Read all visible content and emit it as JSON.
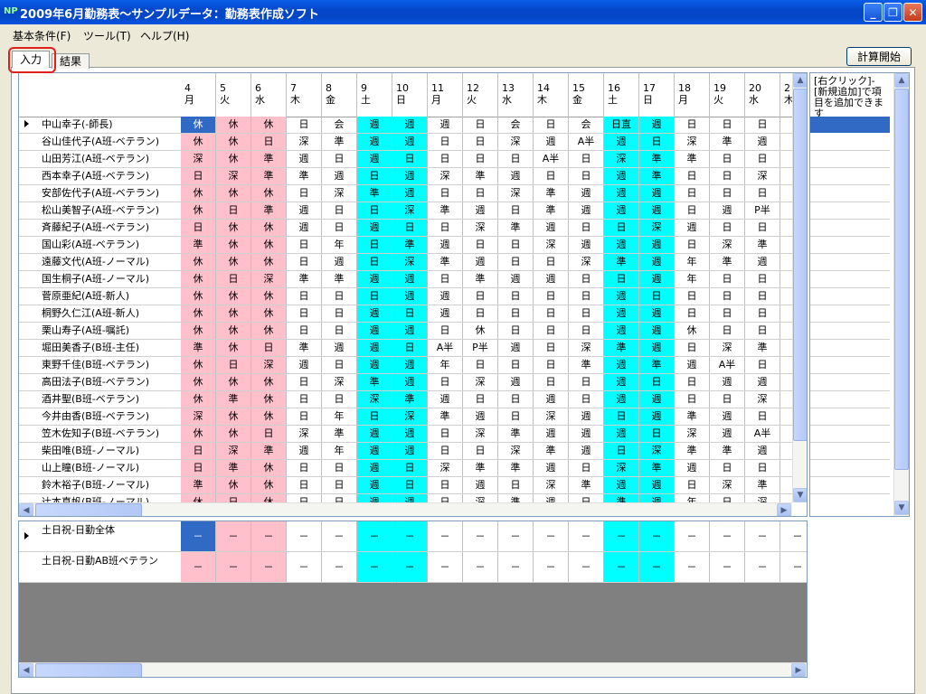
{
  "window": {
    "title": "2009年6月勤務表～サンプルデータ：勤務表作成ソフト",
    "app_icon_label": "NP",
    "btn_min": "_",
    "btn_max": "❐",
    "btn_close": "✕"
  },
  "menu": [
    {
      "label": "基本条件(F)"
    },
    {
      "label": "ツール(T)"
    },
    {
      "label": "ヘルプ(H)"
    }
  ],
  "tabs": {
    "input": "入力",
    "result": "結果"
  },
  "calc_button": "計算開始",
  "side_panel": {
    "hint": "[右クリック]-[新規追加]で項目を追加できます"
  },
  "colors": {
    "pink": "#ffbfcb",
    "cyan": "#00ffff",
    "selected": "#316ac5"
  },
  "days": [
    {
      "d": "4",
      "w": "月",
      "c": "p"
    },
    {
      "d": "5",
      "w": "火",
      "c": "p"
    },
    {
      "d": "6",
      "w": "水",
      "c": "p"
    },
    {
      "d": "7",
      "w": "木",
      "c": ""
    },
    {
      "d": "8",
      "w": "金",
      "c": ""
    },
    {
      "d": "9",
      "w": "土",
      "c": "c"
    },
    {
      "d": "10",
      "w": "日",
      "c": "c"
    },
    {
      "d": "11",
      "w": "月",
      "c": ""
    },
    {
      "d": "12",
      "w": "火",
      "c": ""
    },
    {
      "d": "13",
      "w": "水",
      "c": ""
    },
    {
      "d": "14",
      "w": "木",
      "c": ""
    },
    {
      "d": "15",
      "w": "金",
      "c": ""
    },
    {
      "d": "16",
      "w": "土",
      "c": "c"
    },
    {
      "d": "17",
      "w": "日",
      "c": "c"
    },
    {
      "d": "18",
      "w": "月",
      "c": ""
    },
    {
      "d": "19",
      "w": "火",
      "c": ""
    },
    {
      "d": "20",
      "w": "水",
      "c": ""
    },
    {
      "d": "2",
      "w": "木",
      "c": ""
    }
  ],
  "staff": [
    {
      "name": "中山幸子(-師長)",
      "shifts": [
        "休",
        "休",
        "休",
        "日",
        "会",
        "週",
        "週",
        "週",
        "日",
        "会",
        "日",
        "会",
        "日直",
        "週",
        "日",
        "日",
        "日",
        ""
      ]
    },
    {
      "name": "谷山佳代子(A班-ベテラン)",
      "shifts": [
        "休",
        "休",
        "日",
        "深",
        "準",
        "週",
        "週",
        "日",
        "日",
        "深",
        "週",
        "A半",
        "週",
        "日",
        "深",
        "準",
        "週",
        ""
      ]
    },
    {
      "name": "山田芳江(A班-ベテラン)",
      "shifts": [
        "深",
        "休",
        "準",
        "週",
        "日",
        "週",
        "日",
        "日",
        "日",
        "日",
        "A半",
        "日",
        "深",
        "準",
        "準",
        "日",
        "日",
        ""
      ]
    },
    {
      "name": "西本幸子(A班-ベテラン)",
      "shifts": [
        "日",
        "深",
        "準",
        "準",
        "週",
        "日",
        "週",
        "深",
        "準",
        "週",
        "日",
        "日",
        "週",
        "準",
        "日",
        "日",
        "深",
        ""
      ]
    },
    {
      "name": "安部佐代子(A班-ベテラン)",
      "shifts": [
        "休",
        "休",
        "休",
        "日",
        "深",
        "準",
        "週",
        "日",
        "日",
        "深",
        "準",
        "週",
        "週",
        "週",
        "日",
        "日",
        "日",
        ""
      ]
    },
    {
      "name": "松山美智子(A班-ベテラン)",
      "shifts": [
        "休",
        "日",
        "準",
        "週",
        "日",
        "日",
        "深",
        "準",
        "週",
        "日",
        "準",
        "週",
        "週",
        "週",
        "日",
        "週",
        "P半",
        ""
      ]
    },
    {
      "name": "斉藤紀子(A班-ベテラン)",
      "shifts": [
        "日",
        "休",
        "休",
        "週",
        "日",
        "週",
        "日",
        "日",
        "深",
        "準",
        "週",
        "日",
        "日",
        "深",
        "週",
        "日",
        "日",
        ""
      ]
    },
    {
      "name": "国山彩(A班-ベテラン)",
      "shifts": [
        "準",
        "休",
        "休",
        "日",
        "年",
        "日",
        "準",
        "週",
        "日",
        "日",
        "深",
        "週",
        "週",
        "週",
        "日",
        "深",
        "準",
        ""
      ]
    },
    {
      "name": "遠藤文代(A班-ノーマル)",
      "shifts": [
        "休",
        "休",
        "休",
        "日",
        "週",
        "日",
        "深",
        "準",
        "週",
        "日",
        "日",
        "深",
        "準",
        "週",
        "年",
        "準",
        "週",
        ""
      ]
    },
    {
      "name": "国生桐子(A班-ノーマル)",
      "shifts": [
        "休",
        "日",
        "深",
        "準",
        "準",
        "週",
        "週",
        "日",
        "準",
        "週",
        "週",
        "日",
        "日",
        "週",
        "年",
        "日",
        "日",
        ""
      ]
    },
    {
      "name": "菅原亜紀(A班-新人)",
      "shifts": [
        "休",
        "休",
        "休",
        "日",
        "日",
        "日",
        "週",
        "週",
        "日",
        "日",
        "日",
        "日",
        "週",
        "日",
        "日",
        "日",
        "日",
        ""
      ]
    },
    {
      "name": "桐野久仁江(A班-新人)",
      "shifts": [
        "休",
        "休",
        "休",
        "日",
        "日",
        "週",
        "日",
        "週",
        "日",
        "日",
        "日",
        "日",
        "週",
        "週",
        "日",
        "日",
        "日",
        ""
      ]
    },
    {
      "name": "栗山寿子(A班-嘱託)",
      "shifts": [
        "休",
        "休",
        "休",
        "日",
        "日",
        "週",
        "週",
        "日",
        "休",
        "日",
        "日",
        "日",
        "週",
        "週",
        "休",
        "日",
        "日",
        ""
      ]
    },
    {
      "name": "堀田美香子(B班-主任)",
      "shifts": [
        "準",
        "休",
        "日",
        "準",
        "週",
        "週",
        "日",
        "A半",
        "P半",
        "週",
        "日",
        "深",
        "準",
        "週",
        "日",
        "深",
        "準",
        ""
      ]
    },
    {
      "name": "東野千佳(B班-ベテラン)",
      "shifts": [
        "休",
        "日",
        "深",
        "週",
        "日",
        "週",
        "週",
        "年",
        "日",
        "日",
        "日",
        "準",
        "週",
        "準",
        "週",
        "A半",
        "日",
        ""
      ]
    },
    {
      "name": "高田法子(B班-ベテラン)",
      "shifts": [
        "休",
        "休",
        "休",
        "日",
        "深",
        "準",
        "週",
        "日",
        "深",
        "週",
        "日",
        "日",
        "週",
        "日",
        "日",
        "週",
        "週",
        ""
      ]
    },
    {
      "name": "酒井聖(B班-ベテラン)",
      "shifts": [
        "休",
        "準",
        "休",
        "日",
        "日",
        "深",
        "準",
        "週",
        "日",
        "日",
        "週",
        "日",
        "週",
        "週",
        "日",
        "日",
        "深",
        ""
      ]
    },
    {
      "name": "今井由香(B班-ベテラン)",
      "shifts": [
        "深",
        "休",
        "休",
        "日",
        "年",
        "日",
        "深",
        "準",
        "週",
        "日",
        "深",
        "週",
        "日",
        "週",
        "準",
        "週",
        "日",
        ""
      ]
    },
    {
      "name": "笠木佐知子(B班-ベテラン)",
      "shifts": [
        "休",
        "休",
        "日",
        "深",
        "準",
        "週",
        "週",
        "日",
        "深",
        "準",
        "週",
        "週",
        "週",
        "日",
        "深",
        "週",
        "A半",
        ""
      ]
    },
    {
      "name": "柴田唯(B班-ノーマル)",
      "shifts": [
        "日",
        "深",
        "準",
        "週",
        "年",
        "週",
        "週",
        "日",
        "日",
        "深",
        "準",
        "週",
        "日",
        "深",
        "準",
        "準",
        "週",
        ""
      ]
    },
    {
      "name": "山上瞳(B班-ノーマル)",
      "shifts": [
        "日",
        "準",
        "休",
        "日",
        "日",
        "週",
        "日",
        "深",
        "準",
        "準",
        "週",
        "日",
        "深",
        "準",
        "週",
        "日",
        "日",
        ""
      ]
    },
    {
      "name": "鈴木裕子(B班-ノーマル)",
      "shifts": [
        "準",
        "休",
        "休",
        "日",
        "日",
        "週",
        "日",
        "日",
        "週",
        "日",
        "深",
        "準",
        "週",
        "週",
        "日",
        "深",
        "準",
        ""
      ]
    },
    {
      "name": "辻本真帆(B班-ノーマル)",
      "shifts": [
        "休",
        "日",
        "休",
        "日",
        "日",
        "週",
        "週",
        "日",
        "深",
        "準",
        "週",
        "日",
        "準",
        "週",
        "年",
        "日",
        "深",
        ""
      ]
    }
  ],
  "summary": [
    {
      "name": "土日祝-日勤全体",
      "cells": [
        "－",
        "－",
        "－",
        "－",
        "－",
        "－",
        "－",
        "－",
        "－",
        "－",
        "－",
        "－",
        "－",
        "－",
        "－",
        "－",
        "－",
        "－"
      ]
    },
    {
      "name": "土日祝-日勤AB班ベテラン",
      "cells": [
        "－",
        "－",
        "－",
        "－",
        "－",
        "－",
        "－",
        "－",
        "－",
        "－",
        "－",
        "－",
        "－",
        "－",
        "－",
        "－",
        "－",
        "－"
      ]
    }
  ],
  "scroll_arrows": {
    "up": "▲",
    "down": "▼",
    "left": "◀",
    "right": "▶"
  }
}
